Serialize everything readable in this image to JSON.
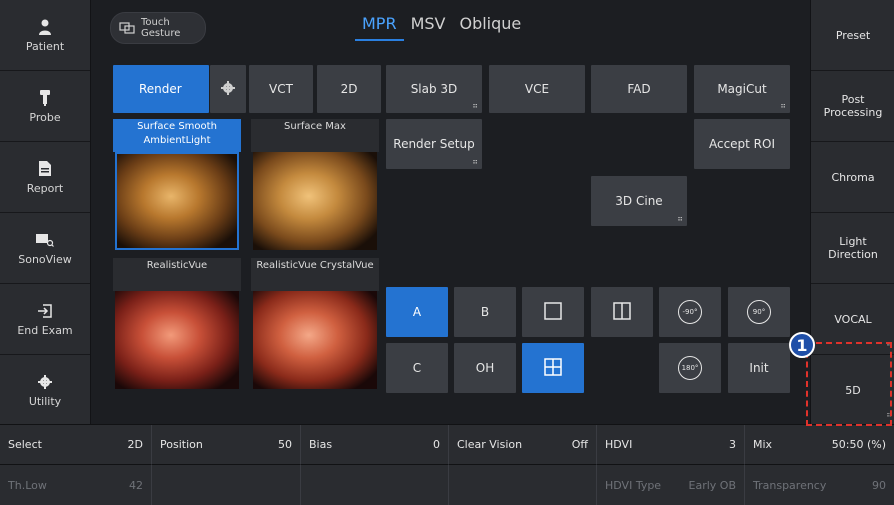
{
  "left_nav": [
    {
      "label": "Patient",
      "icon": "person-icon"
    },
    {
      "label": "Probe",
      "icon": "probe-icon"
    },
    {
      "label": "Report",
      "icon": "report-icon"
    },
    {
      "label": "SonoView",
      "icon": "sonoview-icon"
    },
    {
      "label": "End Exam",
      "icon": "exit-icon"
    },
    {
      "label": "Utility",
      "icon": "gear-icon"
    }
  ],
  "right_nav": [
    {
      "label": "Preset"
    },
    {
      "label": "Post\nProcessing"
    },
    {
      "label": "Chroma"
    },
    {
      "label": "Light\nDirection"
    },
    {
      "label": "VOCAL"
    },
    {
      "label": "5D"
    }
  ],
  "touch_gesture": {
    "line1": "Touch",
    "line2": "Gesture"
  },
  "tabs": [
    {
      "label": "MPR",
      "active": true
    },
    {
      "label": "MSV",
      "active": false
    },
    {
      "label": "Oblique",
      "active": false
    }
  ],
  "buttons": {
    "render": "Render",
    "vct": "VCT",
    "twod": "2D",
    "slab3d": "Slab 3D",
    "vce": "VCE",
    "fad": "FAD",
    "magicut": "MagiCut",
    "render_setup": "Render Setup",
    "accept_roi": "Accept ROI",
    "cine3d": "3D Cine",
    "a": "A",
    "b": "B",
    "c": "C",
    "oh": "OH",
    "init": "Init",
    "rot_m90": "-90°",
    "rot_90": "90°",
    "rot_180": "180°"
  },
  "thumbnails": [
    {
      "label": "Surface Smooth\nAmbientLight",
      "selected": true
    },
    {
      "label": "Surface Max",
      "selected": false
    },
    {
      "label": "RealisticVue",
      "selected": false
    },
    {
      "label": "RealisticVue CrystalVue",
      "selected": false
    }
  ],
  "bottom_top": [
    {
      "label": "Select",
      "value": "2D"
    },
    {
      "label": "Position",
      "value": "50"
    },
    {
      "label": "Bias",
      "value": "0"
    },
    {
      "label": "Clear Vision",
      "value": "Off"
    },
    {
      "label": "HDVI",
      "value": "3"
    },
    {
      "label": "Mix",
      "value": "50:50 (%)"
    }
  ],
  "bottom_bottom": [
    {
      "label": "Th.Low",
      "value": "42"
    },
    {
      "label": "",
      "value": ""
    },
    {
      "label": "",
      "value": ""
    },
    {
      "label": "",
      "value": ""
    },
    {
      "label": "HDVI Type",
      "value": "Early OB"
    },
    {
      "label": "Transparency",
      "value": "90"
    }
  ],
  "callout_number": "1",
  "colors": {
    "accent": "#2473d1",
    "callout": "#e0322b",
    "tab_active": "#4aa3ff"
  }
}
